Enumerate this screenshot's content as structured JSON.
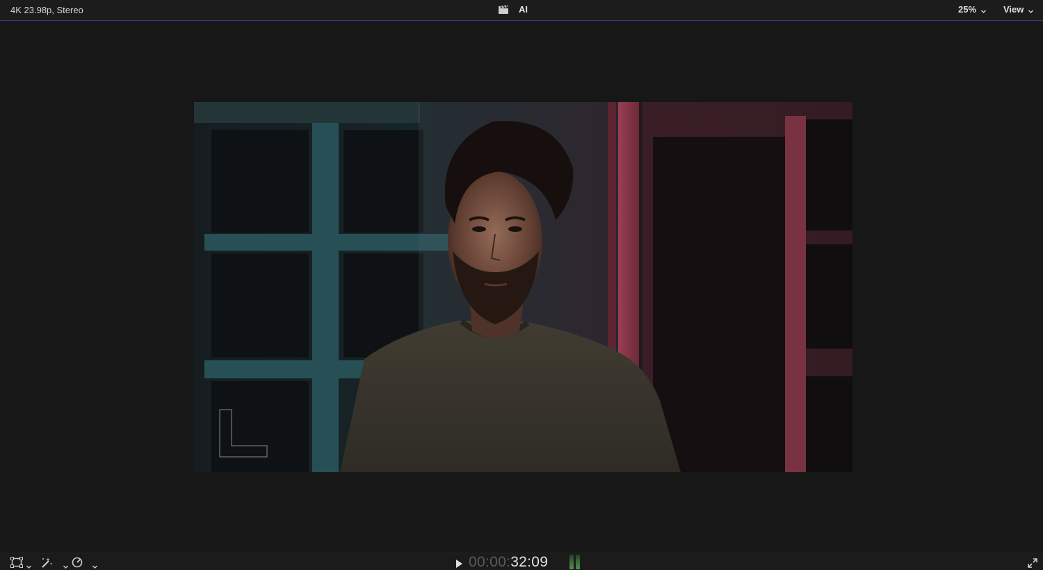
{
  "topbar": {
    "format": "4K 23.98p, Stereo",
    "clip_icon": "clapperboard-icon",
    "clip_name": "AI",
    "zoom": "25%",
    "view": "View"
  },
  "viewer": {
    "content": "video-frame"
  },
  "bottombar": {
    "transform_tool_icon": "transform-icon",
    "enhance_tool_icon": "magic-wand-icon",
    "retime_tool_icon": "speedometer-icon",
    "timecode_dim": "00:00:",
    "timecode_bright": "32:09",
    "meters_color": "#4f8f4f",
    "fullscreen_icon": "fullscreen-icon"
  }
}
